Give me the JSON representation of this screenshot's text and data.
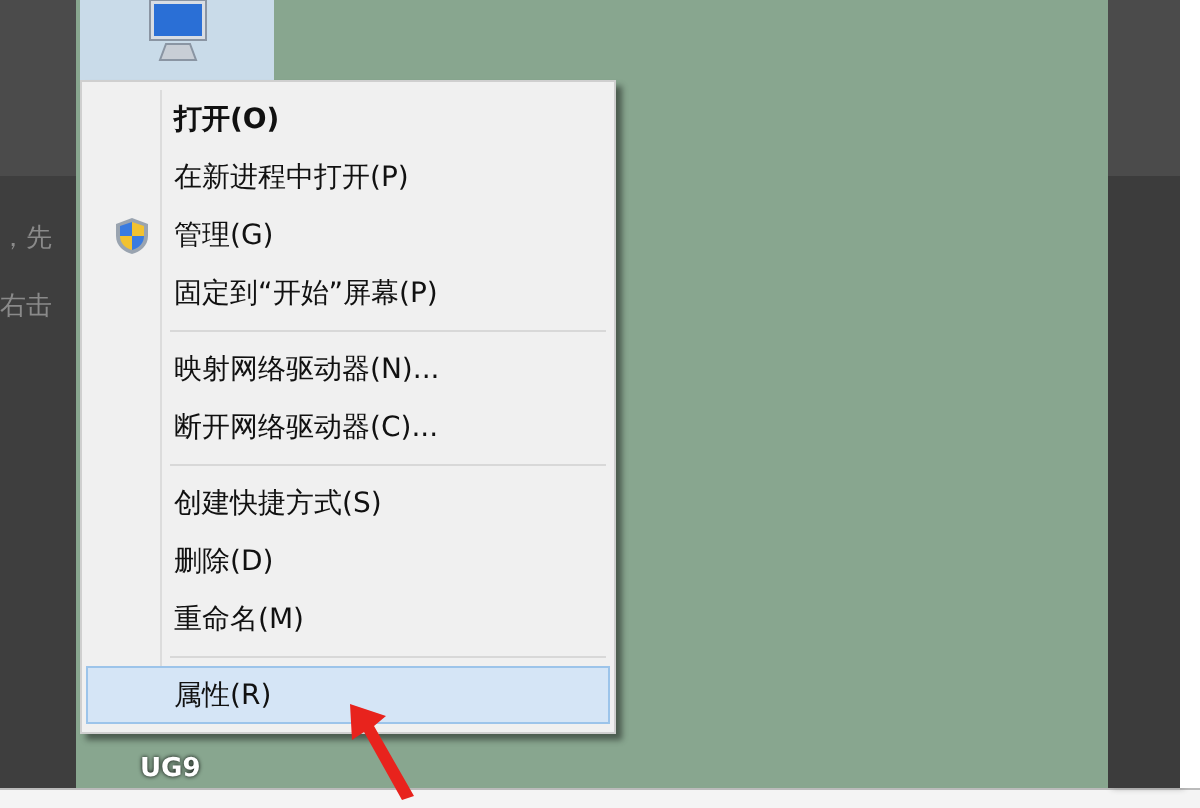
{
  "background_text": [
    "，先",
    "右击"
  ],
  "desktop": {
    "computer_icon": {
      "selected": true
    },
    "icon_label": "UG9"
  },
  "context_menu": {
    "items": [
      {
        "kind": "item",
        "label": "打开(O)",
        "default": true,
        "shield": false,
        "selected": false
      },
      {
        "kind": "item",
        "label": "在新进程中打开(P)",
        "default": false,
        "shield": false,
        "selected": false
      },
      {
        "kind": "item",
        "label": "管理(G)",
        "default": false,
        "shield": true,
        "selected": false
      },
      {
        "kind": "item",
        "label": "固定到“开始”屏幕(P)",
        "default": false,
        "shield": false,
        "selected": false
      },
      {
        "kind": "separator"
      },
      {
        "kind": "item",
        "label": "映射网络驱动器(N)...",
        "default": false,
        "shield": false,
        "selected": false
      },
      {
        "kind": "item",
        "label": "断开网络驱动器(C)...",
        "default": false,
        "shield": false,
        "selected": false
      },
      {
        "kind": "separator"
      },
      {
        "kind": "item",
        "label": "创建快捷方式(S)",
        "default": false,
        "shield": false,
        "selected": false
      },
      {
        "kind": "item",
        "label": "删除(D)",
        "default": false,
        "shield": false,
        "selected": false
      },
      {
        "kind": "item",
        "label": "重命名(M)",
        "default": false,
        "shield": false,
        "selected": false
      },
      {
        "kind": "separator"
      },
      {
        "kind": "item",
        "label": "属性(R)",
        "default": false,
        "shield": false,
        "selected": true
      }
    ]
  }
}
